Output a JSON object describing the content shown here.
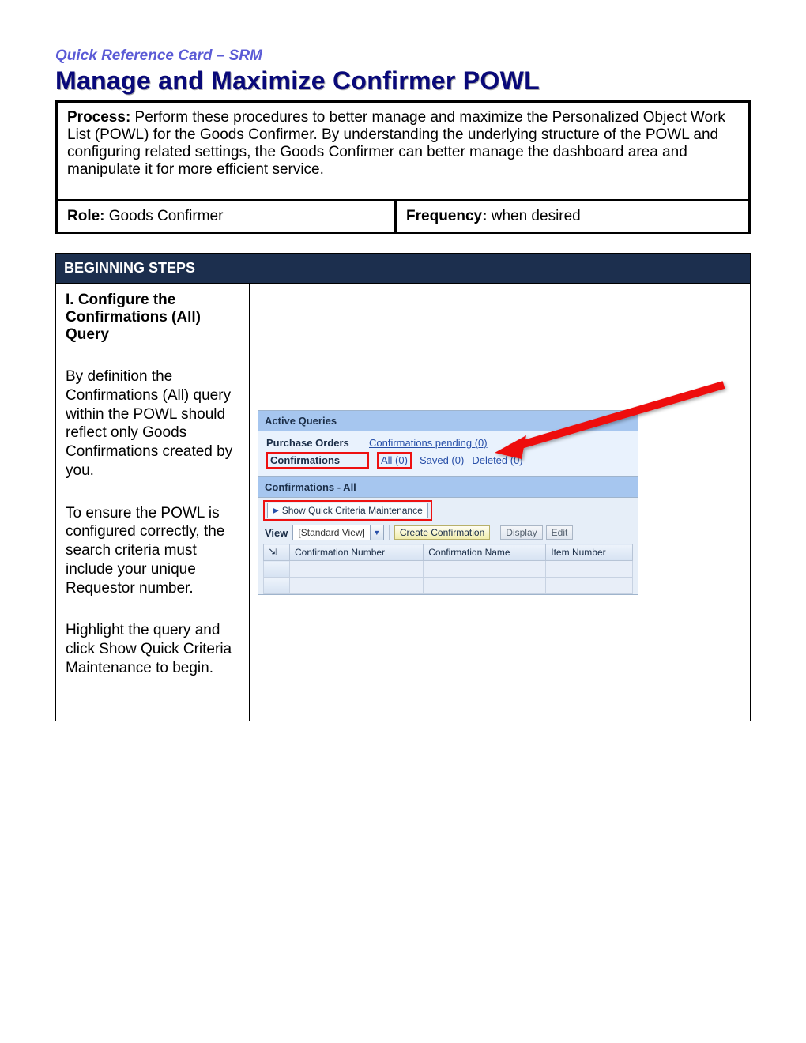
{
  "header": {
    "subtitle": "Quick Reference Card – SRM",
    "title": "Manage and Maximize Confirmer POWL"
  },
  "process": {
    "label": "Process:",
    "text": " Perform these procedures to better manage and maximize the Personalized Object Work List (POWL) for the Goods Confirmer. By understanding the underlying structure of the POWL and configuring related settings, the Goods Confirmer can better manage the dashboard area and manipulate it for more efficient service."
  },
  "role": {
    "label": "Role:",
    "value": " Goods Confirmer"
  },
  "frequency": {
    "label": "Frequency:",
    "value": " when desired"
  },
  "section_header": "BEGINNING STEPS",
  "step": {
    "title": "I. Configure the Confirmations (All) Query",
    "p1": "By definition the Confirmations (All) query within the POWL should reflect only Goods Confirmations created by you.",
    "p2": "To ensure the POWL is configured correctly, the search criteria must include your unique Requestor number.",
    "p3": "Highlight the query and click Show Quick Criteria Maintenance to begin."
  },
  "srm": {
    "active_queries": "Active Queries",
    "po_label": "Purchase Orders",
    "po_link": "Confirmations pending (0)",
    "conf_label": "Confirmations",
    "conf_all": "All (0)",
    "conf_saved": "Saved (0)",
    "conf_deleted": "Deleted (0)",
    "conf_all_header": "Confirmations - All",
    "sqcm": "Show Quick Criteria Maintenance",
    "view_label": "View",
    "view_value": "[Standard View]",
    "btn_create": "Create Confirmation",
    "btn_display": "Display",
    "btn_edit": "Edit",
    "col1": "Confirmation Number",
    "col2": "Confirmation Name",
    "col3": "Item Number",
    "export_icon": "⇲"
  }
}
